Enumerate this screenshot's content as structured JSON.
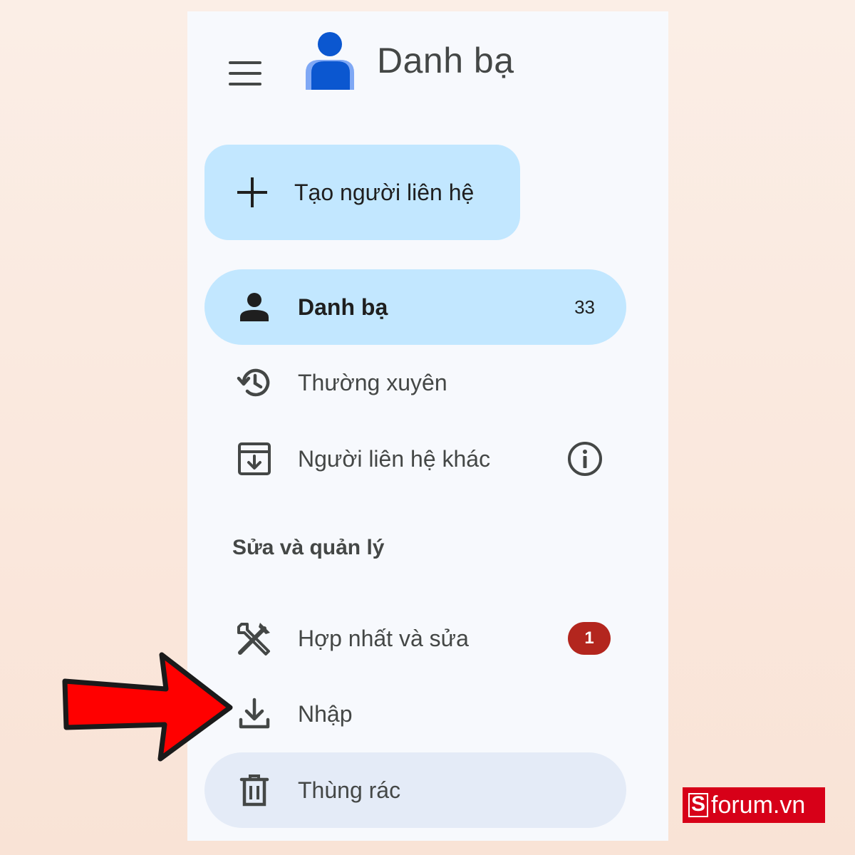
{
  "header": {
    "title": "Danh bạ",
    "menu_icon": "hamburger-menu-icon",
    "logo_icon": "contacts-logo-icon"
  },
  "create_button": {
    "label": "Tạo người liên hệ",
    "icon": "plus-icon"
  },
  "nav": {
    "contacts": {
      "label": "Danh bạ",
      "count": "33",
      "icon": "person-icon"
    },
    "frequent": {
      "label": "Thường xuyên",
      "icon": "history-icon"
    },
    "other": {
      "label": "Người liên hệ khác",
      "icon": "archive-download-icon",
      "info_icon": "info-icon"
    }
  },
  "section": {
    "title": "Sửa và quản lý"
  },
  "manage": {
    "merge": {
      "label": "Hợp nhất và sửa",
      "badge": "1",
      "icon": "tools-icon"
    },
    "import": {
      "label": "Nhập",
      "icon": "download-icon"
    },
    "trash": {
      "label": "Thùng rác",
      "icon": "trash-icon"
    }
  },
  "watermark": {
    "prefix": "S",
    "text": "forum.vn"
  },
  "colors": {
    "accent_bg": "#c2e7ff",
    "hover_bg": "#e4ebf7",
    "badge": "#b3261e",
    "arrow": "#ff0000",
    "brand": "#d70018"
  }
}
